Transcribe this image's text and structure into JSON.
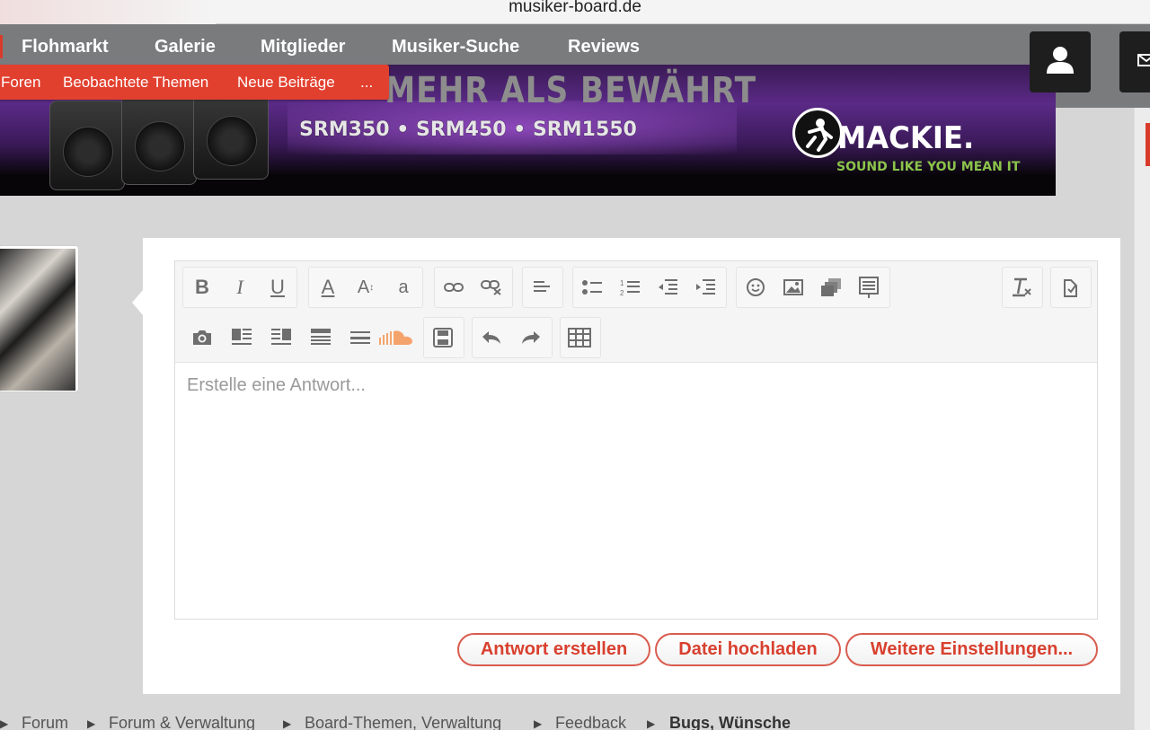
{
  "url": "musiker-board.de",
  "topnav": {
    "items": [
      "Flohmarkt",
      "Galerie",
      "Mitglieder",
      "Musiker-Suche",
      "Reviews"
    ],
    "user_icon": "user-icon",
    "mail_icon": "mail-icon"
  },
  "submenu": {
    "items": [
      "Foren",
      "Beobachtete Themen",
      "Neue Beiträge",
      "..."
    ]
  },
  "banner": {
    "headline": "MEHR ALS BEWÄHRT",
    "models": "SRM350 • SRM450 • SRM1550",
    "brand": "MACKIE.",
    "tagline": "SOUND LIKE YOU MEAN IT"
  },
  "editor": {
    "placeholder": "Erstelle eine Antwort...",
    "toolbar_icons": [
      "bold-icon",
      "italic-icon",
      "underline-icon",
      "font-color-icon",
      "font-size-icon",
      "font-family-icon",
      "link-icon",
      "unlink-icon",
      "align-icon",
      "bulleted-list-icon",
      "numbered-list-icon",
      "outdent-icon",
      "indent-icon",
      "smiley-icon",
      "image-icon",
      "media-icon",
      "template-icon",
      "remove-format-icon",
      "toggle-source-icon",
      "camera-icon",
      "layout-1-icon",
      "layout-2-icon",
      "layout-3-icon",
      "layout-4-icon",
      "soundcloud-icon",
      "save-draft-icon",
      "undo-icon",
      "redo-icon",
      "table-icon"
    ],
    "toolbar_labels": {
      "bold": "B",
      "italic": "I",
      "underline": "U",
      "font_color": "A",
      "font_size": "A",
      "font_family": "a"
    }
  },
  "actions": {
    "submit": "Antwort erstellen",
    "upload": "Datei hochladen",
    "more": "Weitere Einstellungen..."
  },
  "breadcrumb": [
    "Forum",
    "Forum & Verwaltung",
    "Board-Themen, Verwaltung",
    "Feedback",
    "Bugs, Wünsche"
  ],
  "colors": {
    "accent": "#e2402f",
    "nav_bg": "#7a7b7d",
    "button_text": "#d8402f"
  }
}
